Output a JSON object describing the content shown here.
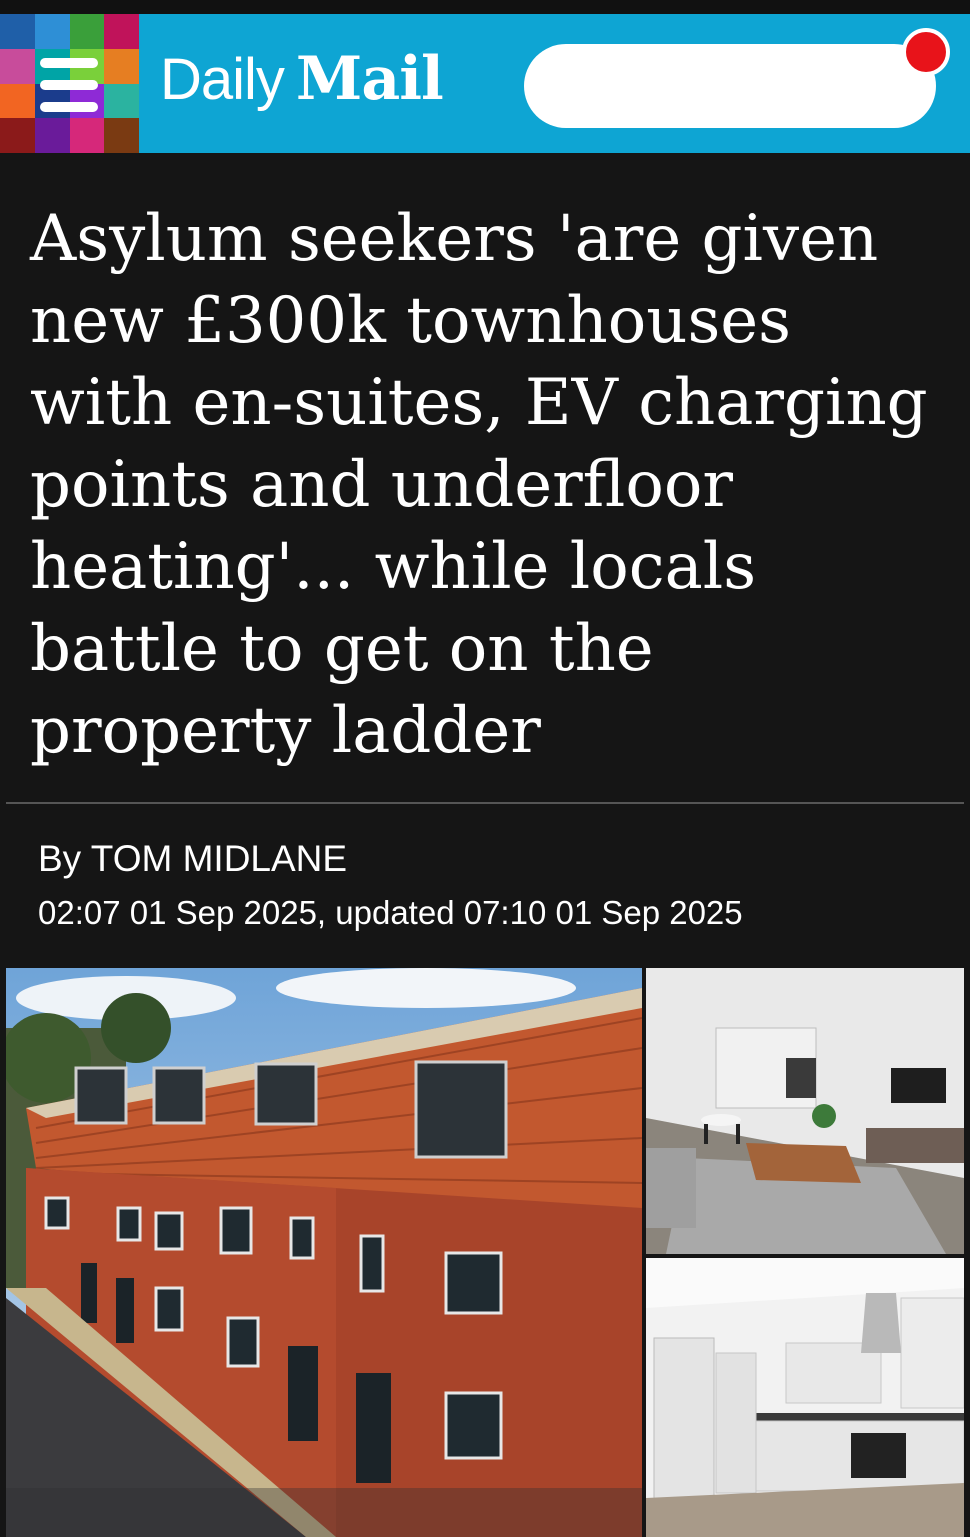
{
  "header": {
    "brand_daily": "Daily",
    "brand_mail": "Mail",
    "brand_color": "#0ea5d3",
    "mosaic_colors": [
      "#1f5fa8",
      "#2e8fd6",
      "#3a9f3a",
      "#c0135a",
      "#c84c9b",
      "#00a4a6",
      "#7ad03a",
      "#e67e22",
      "#f26522",
      "#1b3c8c",
      "#8e2ad6",
      "#2bb3a0",
      "#8b1a1a",
      "#6a1b9a",
      "#d6287a",
      "#7a3a12"
    ],
    "menu_icon": "hamburger-menu-icon",
    "search_placeholder": "",
    "notification_color": "#e8131a"
  },
  "article": {
    "headline": "Asylum seekers 'are given new £300k townhouses with en-suites, EV charging points and underfloor heating'... while locals battle to get on the property ladder",
    "byline": "By TOM MIDLANE",
    "timestamp": "02:07 01 Sep 2025, updated 07:10 01 Sep 2025"
  },
  "images": [
    {
      "name": "townhouses-exterior-photo"
    },
    {
      "name": "living-room-photo"
    },
    {
      "name": "kitchen-photo"
    }
  ]
}
